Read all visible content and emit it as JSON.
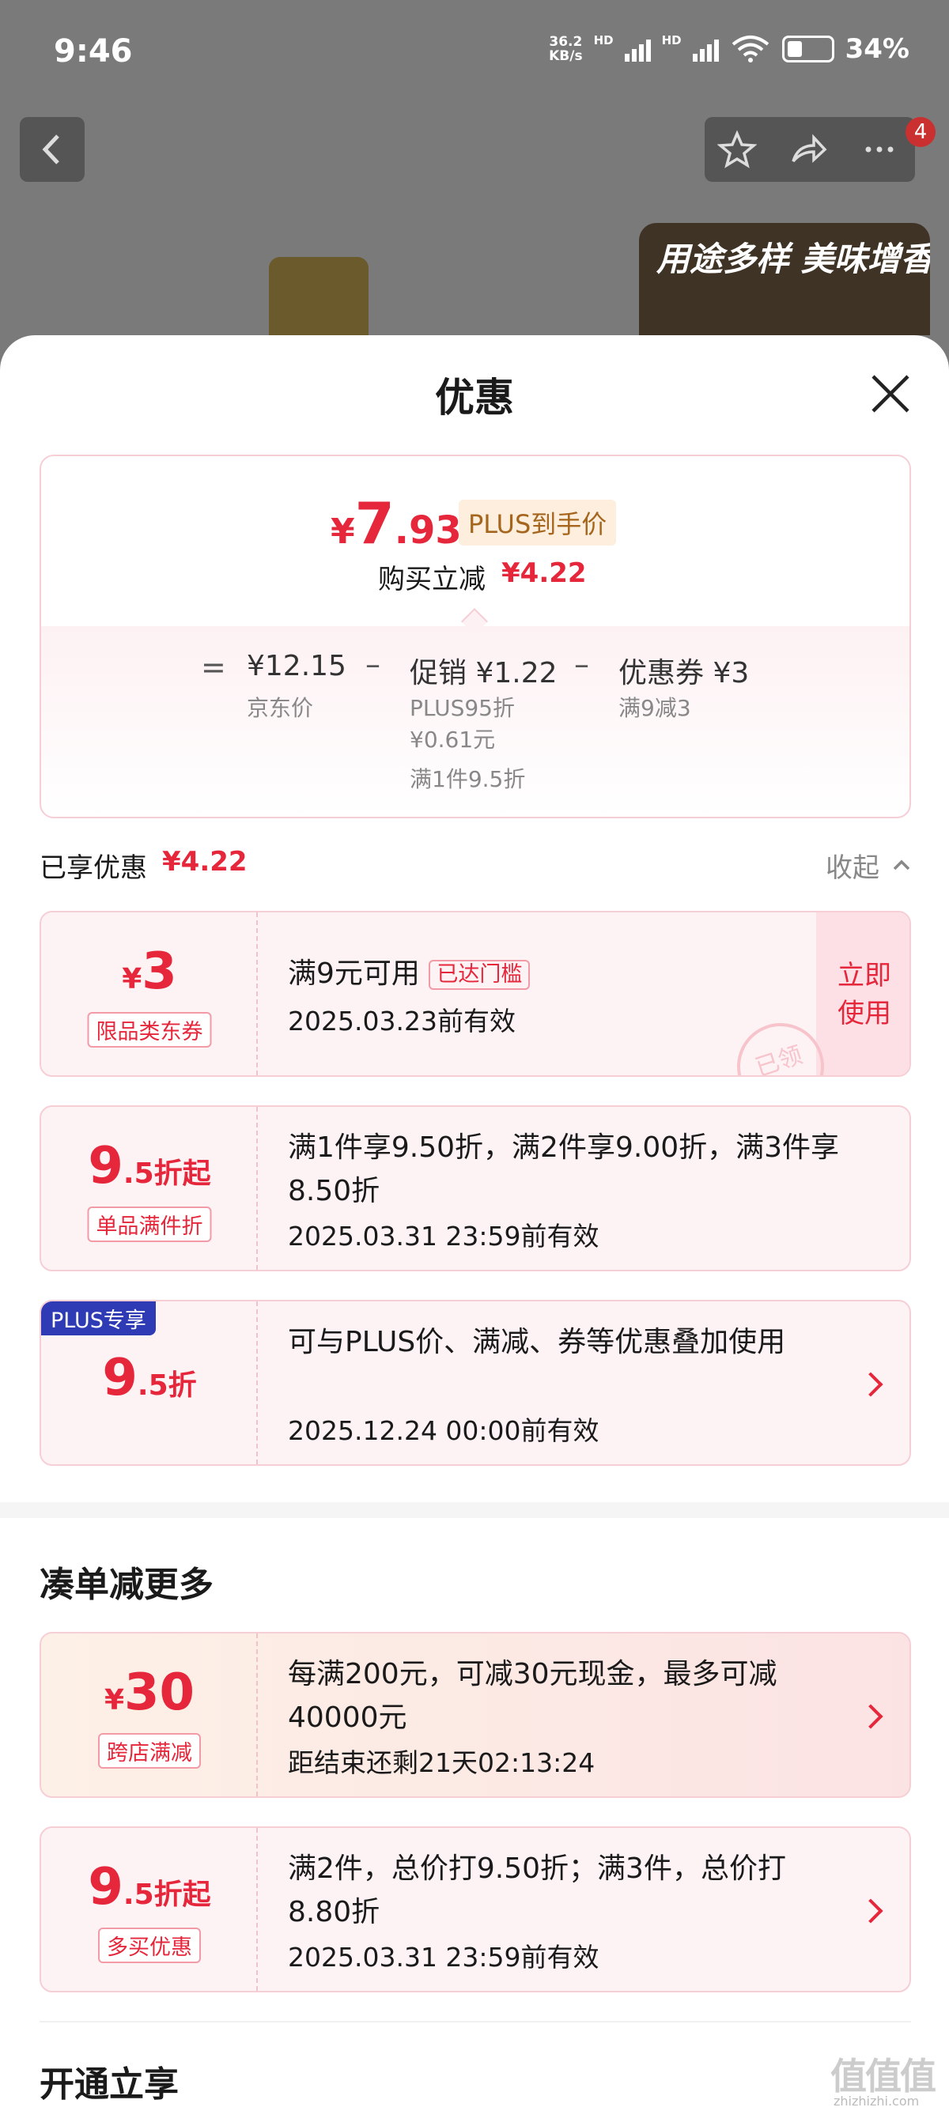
{
  "status_bar": {
    "time": "9:46",
    "net_top": "36.2",
    "net_bottom": "KB/s",
    "hd1": "HD",
    "hd2": "HD",
    "wifi_sub": "6",
    "battery": "34%"
  },
  "banner": {
    "text": "用途多样 美味增香"
  },
  "nav": {
    "badge": "4"
  },
  "sheet": {
    "title": "优惠"
  },
  "price": {
    "currency": "¥",
    "big": "7",
    "dec": ".93",
    "plus_tag": "PLUS到手价",
    "reduce_label": "购买立减",
    "reduce_value": "¥4.22",
    "eq": "=",
    "jd_price": "¥12.15",
    "jd_label": "京东价",
    "minus1": "–",
    "promo_title": "促销 ¥1.22",
    "promo_line1": "PLUS95折",
    "promo_line2": "¥0.61元",
    "promo_line3": "满1件9.5折",
    "minus2": "–",
    "coupon_title": "优惠券 ¥3",
    "coupon_line1": "满9减3"
  },
  "enjoyed": {
    "label": "已享优惠",
    "value": "¥4.22",
    "collapse": "收起"
  },
  "coupons": [
    {
      "amount_cur": "¥",
      "amount": "3",
      "tag": "限品类东券",
      "line1": "满9元可用",
      "badge": "已达门槛",
      "line2": "2025.03.23前有效",
      "action1": "立即",
      "action2": "使用",
      "stamp": "已领"
    },
    {
      "amount": "9",
      "amount_suffix": ".5折起",
      "tag": "单品满件折",
      "line1": "满1件享9.50折，满2件享9.00折，满3件享8.50折",
      "line2": "2025.03.31 23:59前有效"
    },
    {
      "plus_label": "PLUS专享",
      "amount": "9",
      "amount_suffix": ".5折",
      "line1": "可与PLUS价、满减、券等优惠叠加使用",
      "line2": "2025.12.24 00:00前有效"
    }
  ],
  "more": {
    "title": "凑单减更多",
    "items": [
      {
        "amount_cur": "¥",
        "amount": "30",
        "tag": "跨店满减",
        "line1": "每满200元，可减30元现金，最多可减40000元",
        "line2": "距结束还剩21天02:13:24"
      },
      {
        "amount": "9",
        "amount_suffix": ".5折起",
        "tag": "多买优惠",
        "line1": "满2件，总价打9.50折；满3件，总价打8.80折",
        "line2": "2025.03.31 23:59前有效"
      }
    ]
  },
  "open": {
    "title": "开通立享"
  },
  "watermark": {
    "logo": "值值值",
    "url": "zhizhizhi.com"
  }
}
